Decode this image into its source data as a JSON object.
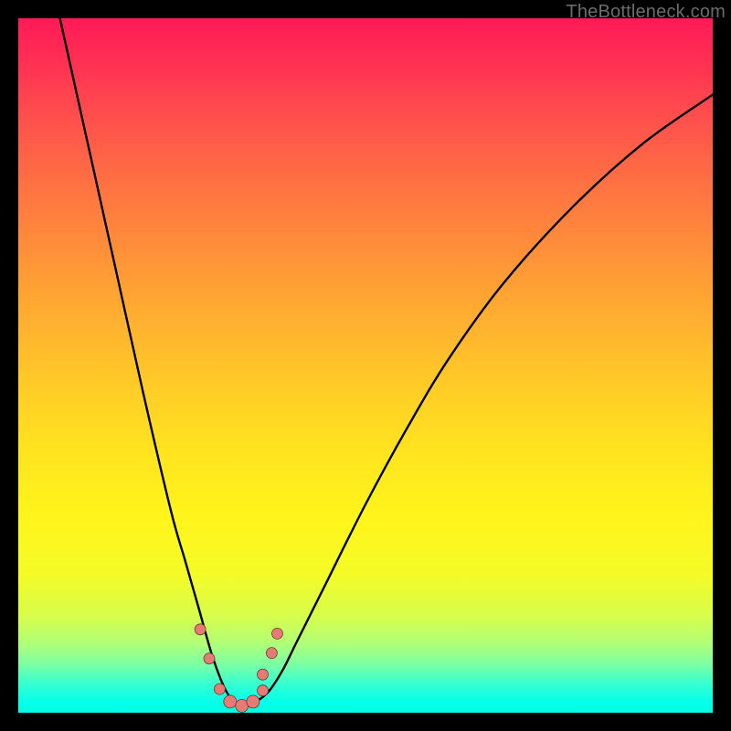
{
  "watermark": "TheBottleneck.com",
  "colors": {
    "marker_fill": "#e77a74",
    "marker_stroke": "#6b3a36",
    "curve_stroke": "#000000"
  },
  "chart_data": {
    "type": "line",
    "title": "",
    "xlabel": "",
    "ylabel": "",
    "xlim": [
      0,
      100
    ],
    "ylim": [
      0,
      100
    ],
    "grid": false,
    "legend": false,
    "note": "Axis scale is unlabeled; values are percentage positions estimated from the rendered figure. y=0 is bottom, y=100 is top. Curve shows bottleneck severity (higher = worse) with minimum near x≈31.",
    "series": [
      {
        "name": "bottleneck-curve",
        "x": [
          6,
          10,
          14,
          18,
          22,
          24,
          26,
          28,
          30,
          32,
          34,
          36,
          38,
          40,
          44,
          50,
          56,
          62,
          70,
          80,
          90,
          100
        ],
        "y": [
          100,
          82,
          64,
          46,
          29,
          22,
          15,
          8,
          3,
          1,
          1.5,
          3,
          6,
          10,
          18,
          30,
          41,
          51,
          62,
          73,
          82,
          89
        ]
      }
    ],
    "markers": {
      "name": "highlighted-points",
      "x": [
        26.2,
        27.5,
        29.0,
        30.5,
        32.2,
        33.8,
        35.2,
        35.2,
        36.5,
        37.3
      ],
      "y": [
        12.0,
        7.8,
        3.4,
        1.6,
        1.0,
        1.6,
        3.2,
        5.5,
        8.6,
        11.4
      ],
      "r": [
        6,
        6,
        6,
        7,
        7,
        7,
        6,
        6,
        6,
        6
      ]
    }
  }
}
